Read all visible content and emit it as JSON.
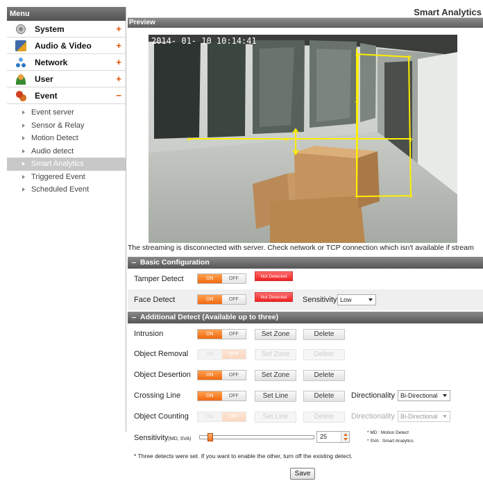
{
  "sidebar": {
    "header": "Menu",
    "items": [
      {
        "label": "System",
        "sign": "+"
      },
      {
        "label": "Audio & Video",
        "sign": "+"
      },
      {
        "label": "Network",
        "sign": "+"
      },
      {
        "label": "User",
        "sign": "+"
      },
      {
        "label": "Event",
        "sign": "−"
      }
    ],
    "sub_items": [
      "Event server",
      "Sensor & Relay",
      "Motion Detect",
      "Audio detect",
      "Smart Analytics",
      "Triggered Event",
      "Scheduled Event"
    ],
    "active_sub_item": "Smart Analytics"
  },
  "page": {
    "title": "Smart Analytics",
    "preview_label": "Preview",
    "timestamp": "2014- 01- 10  10:14:41",
    "stream_message": "The streaming is disconnected with server. Check network or TCP connection which isn't available if stream"
  },
  "basic": {
    "header": "Basic Configuration",
    "tamper": {
      "label": "Tamper Detect",
      "on": "ON",
      "off": "OFF",
      "status": "Not Detected"
    },
    "face": {
      "label": "Face Detect",
      "on": "ON",
      "off": "OFF",
      "status": "Not Detected",
      "sensitivity_label": "Sensitivity",
      "sensitivity_value": "Low"
    }
  },
  "additional": {
    "header": "Additional Detect (Available up to three)",
    "on": "ON",
    "off": "OFF",
    "set_zone": "Set Zone",
    "set_line": "Set  Line",
    "delete": "Delete",
    "directionality_label": "Directionality",
    "directionality_value": "Bi-Directional",
    "rows": {
      "intrusion": "Intrusion",
      "object_removal": "Object Removal",
      "object_desertion": "Object Desertion",
      "crossing_line": "Crossing Line",
      "object_counting": "Object Counting"
    },
    "sensitivity_label": "Sensitivity",
    "sensitivity_suffix": "(MD, SVA)",
    "sensitivity_value": "25",
    "note_md": "* MD : Motion Detect",
    "note_sva": "* SVA : Smart Analytics",
    "footnote": "* Three detects were set. If you want to enable the other, turn off the existing detect.",
    "save": "Save"
  },
  "colors": {
    "accent_orange": "#f06a10",
    "detect_red": "#e22222",
    "overlay_yellow": "#ffee00"
  }
}
